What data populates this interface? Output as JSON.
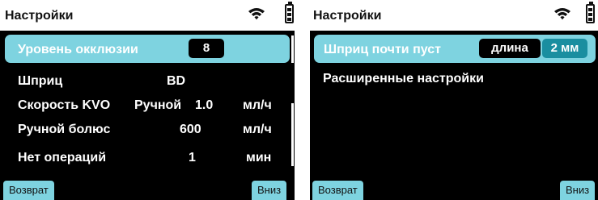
{
  "left_screen": {
    "header": {
      "title": "Настройки",
      "icons": [
        "wifi-icon",
        "battery-icon"
      ]
    },
    "selected_item": {
      "label": "Уровень окклюзии",
      "value": "8"
    },
    "items": [
      {
        "label": "Шприц",
        "value": "BD",
        "unit": ""
      },
      {
        "label": "Скорость KVO",
        "mode": "Ручной",
        "value": "1.0",
        "unit": "мл/ч"
      },
      {
        "label": "Ручной болюс",
        "value": "600",
        "unit": "мл/ч"
      },
      {
        "label": "Нет операций",
        "value": "1",
        "unit": "мин"
      }
    ],
    "footer": {
      "back_label": "Возврат",
      "down_label": "Вниз"
    }
  },
  "right_screen": {
    "header": {
      "title": "Настройки",
      "icons": [
        "wifi-icon",
        "battery-icon"
      ]
    },
    "selected_item": {
      "label": "Шприц почти пуст",
      "option": "длина",
      "value": "2 мм"
    },
    "items": [
      {
        "label": "Расширенные настройки"
      }
    ],
    "footer": {
      "back_label": "Возврат",
      "down_label": "Вниз"
    }
  },
  "colors": {
    "highlight": "#7ed3e0",
    "accent": "#1a8ea0",
    "background": "#000000",
    "header": "#ffffff"
  }
}
